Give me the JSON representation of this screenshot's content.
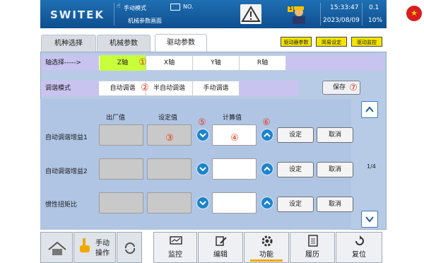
{
  "header": {
    "logo": "SWITEK",
    "mode": "手动模式",
    "screen": "机械参数画面",
    "folder_label": "NO.",
    "worker_badge": "1",
    "time": "15:33:47",
    "date": "2023/08/09",
    "value_top": "0.1",
    "value_bottom": "10%",
    "flag_star": "★"
  },
  "tabs": [
    {
      "label": "机种选择"
    },
    {
      "label": "机械参数"
    },
    {
      "label": "驱动参数"
    }
  ],
  "tags": [
    "驱动器参数",
    "简易设定",
    "驱动监控"
  ],
  "axis_row": {
    "label": "轴选择----->",
    "axes": [
      "Z轴",
      "X轴",
      "Y轴",
      "R轴"
    ],
    "marker": "①"
  },
  "tune_row": {
    "label": "调谐模式",
    "options": [
      "自动调谐",
      "半自动调谐",
      "手动调谐"
    ],
    "marker": "②"
  },
  "save": {
    "label": "保存",
    "marker": "⑦"
  },
  "columns": {
    "factory": "出厂值",
    "setting": "设定值",
    "computed": "计算值"
  },
  "markers": {
    "setting": "③",
    "computed": "④",
    "down": "⑤",
    "up": "⑥"
  },
  "rows": [
    {
      "label": "自动调谐增益1",
      "set": "设定",
      "cancel": "取消"
    },
    {
      "label": "自动调谐增益2",
      "set": "设定",
      "cancel": "取消"
    },
    {
      "label": "惯性扭矩比",
      "set": "设定",
      "cancel": "取消"
    }
  ],
  "pager": {
    "text": "1/4"
  },
  "footer": {
    "manual_line1": "手动",
    "manual_line2": "操作",
    "monitor": "监控",
    "edit": "编辑",
    "function": "功能",
    "history": "履历",
    "reset": "复位"
  },
  "colors": {
    "header": "#1767a8",
    "panel": "#b8cbe6",
    "selected_axis": "#c8ff3a",
    "purple_cells": "#c9c3f0",
    "marker_red": "#e03b1e",
    "round_button": "#1f83c9"
  },
  "icons": [
    "hand-icon",
    "folder-icon",
    "warning-icon",
    "worker-icon",
    "china-flag-icon",
    "home-icon",
    "cycle-icon",
    "monitor-icon",
    "edit-icon",
    "gear-icon",
    "history-icon",
    "reset-icon",
    "chevron-up-icon",
    "chevron-down-icon"
  ]
}
